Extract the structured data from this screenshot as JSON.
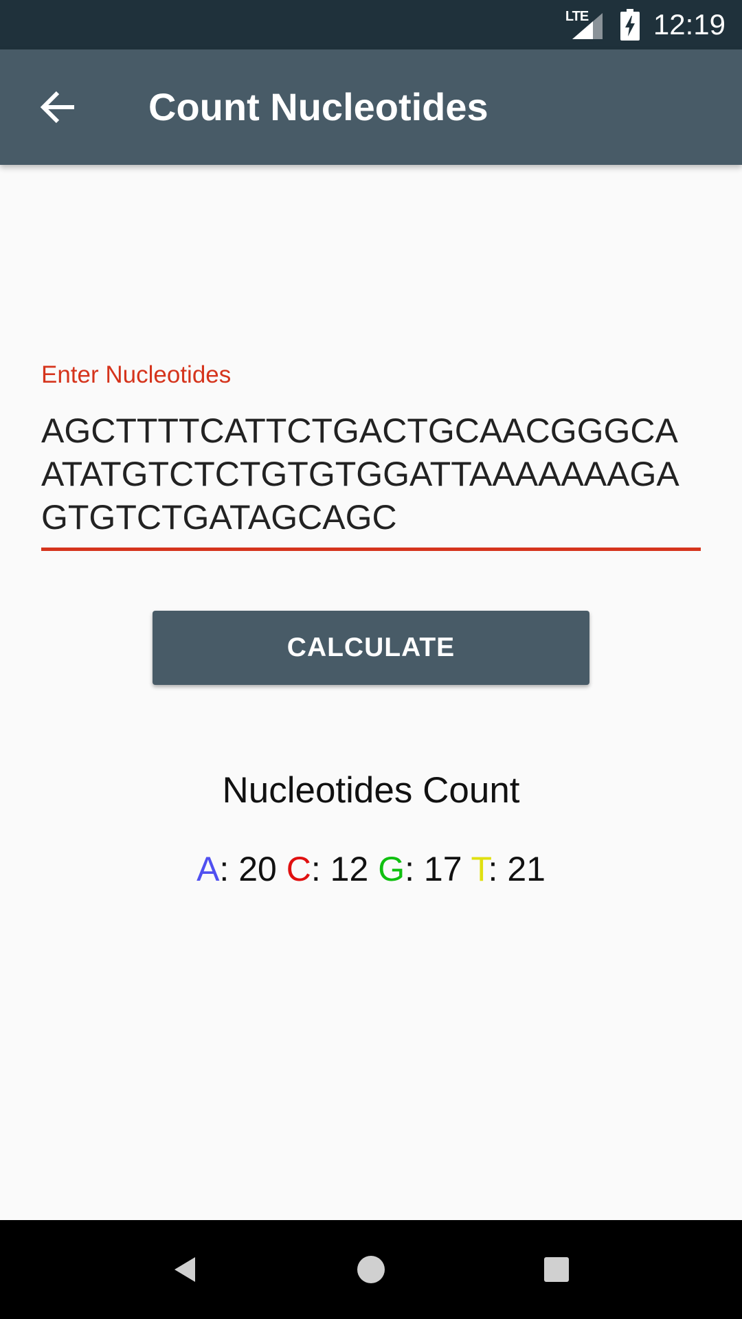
{
  "status_bar": {
    "network": "LTE",
    "time": "12:19"
  },
  "app_bar": {
    "title": "Count Nucleotides"
  },
  "input": {
    "label": "Enter Nucleotides",
    "value": "AGCTTTTCATTCTGACTGCAACGGGCAATATGTCTCTGTGTGGATTAAAAAAAGAGTGTCTGATAGCAGC"
  },
  "button": {
    "label": "CALCULATE"
  },
  "results": {
    "title": "Nucleotides Count",
    "counts": [
      {
        "base": "A",
        "sep": ": ",
        "value": "20",
        "color": "#5050f0"
      },
      {
        "base": "C",
        "sep": ": ",
        "value": "12",
        "color": "#e01010"
      },
      {
        "base": "G",
        "sep": ": ",
        "value": "17",
        "color": "#10c010"
      },
      {
        "base": "T",
        "sep": ": ",
        "value": "21",
        "color": "#e0e010"
      }
    ]
  },
  "colors": {
    "status_bar": "#1f313b",
    "app_bar": "#485b67",
    "accent": "#d5341c",
    "background": "#fafafa"
  }
}
